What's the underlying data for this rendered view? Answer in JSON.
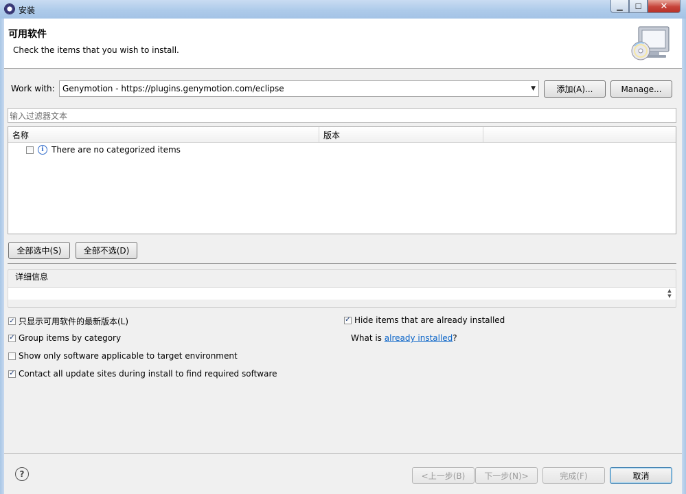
{
  "window": {
    "title": "安装",
    "close_glyph": "✕",
    "min_glyph": "▁",
    "max_glyph": "☐"
  },
  "header": {
    "title": "可用软件",
    "description": "Check the items that you wish to install."
  },
  "work_with": {
    "label": "Work with:",
    "value": "Genymotion - https://plugins.genymotion.com/eclipse",
    "add_label": "添加(A)...",
    "manage_label": "Manage..."
  },
  "filter": {
    "placeholder": "输入过滤器文本"
  },
  "tree": {
    "columns": [
      "名称",
      "版本",
      ""
    ],
    "rows": [
      {
        "label": "There are no categorized items",
        "checked": false,
        "icon": "info-icon"
      }
    ]
  },
  "selection": {
    "select_all_label": "全部选中(S)",
    "deselect_all_label": "全部不选(D)"
  },
  "details": {
    "label": "详细信息"
  },
  "options": {
    "latest_versions": {
      "label": "只显示可用软件的最新版本(L)",
      "checked": true
    },
    "group_by_category": {
      "label": "Group items by category",
      "checked": true
    },
    "applicable_only": {
      "label": "Show only software applicable to target environment",
      "checked": false
    },
    "contact_sites": {
      "label": "Contact all update sites during install to find required software",
      "checked": true
    },
    "hide_installed": {
      "label": "Hide items that are already installed",
      "checked": true
    },
    "what_is_prefix": "What is ",
    "what_is_link": "already installed",
    "what_is_suffix": "?"
  },
  "footer": {
    "help_glyph": "?",
    "back_label": "<上一步(B)",
    "next_label": "下一步(N)>",
    "finish_label": "完成(F)",
    "cancel_label": "取消"
  },
  "colors": {
    "link": "#0a64c8",
    "titlebar": "#aecbea",
    "close": "#c7443a"
  }
}
